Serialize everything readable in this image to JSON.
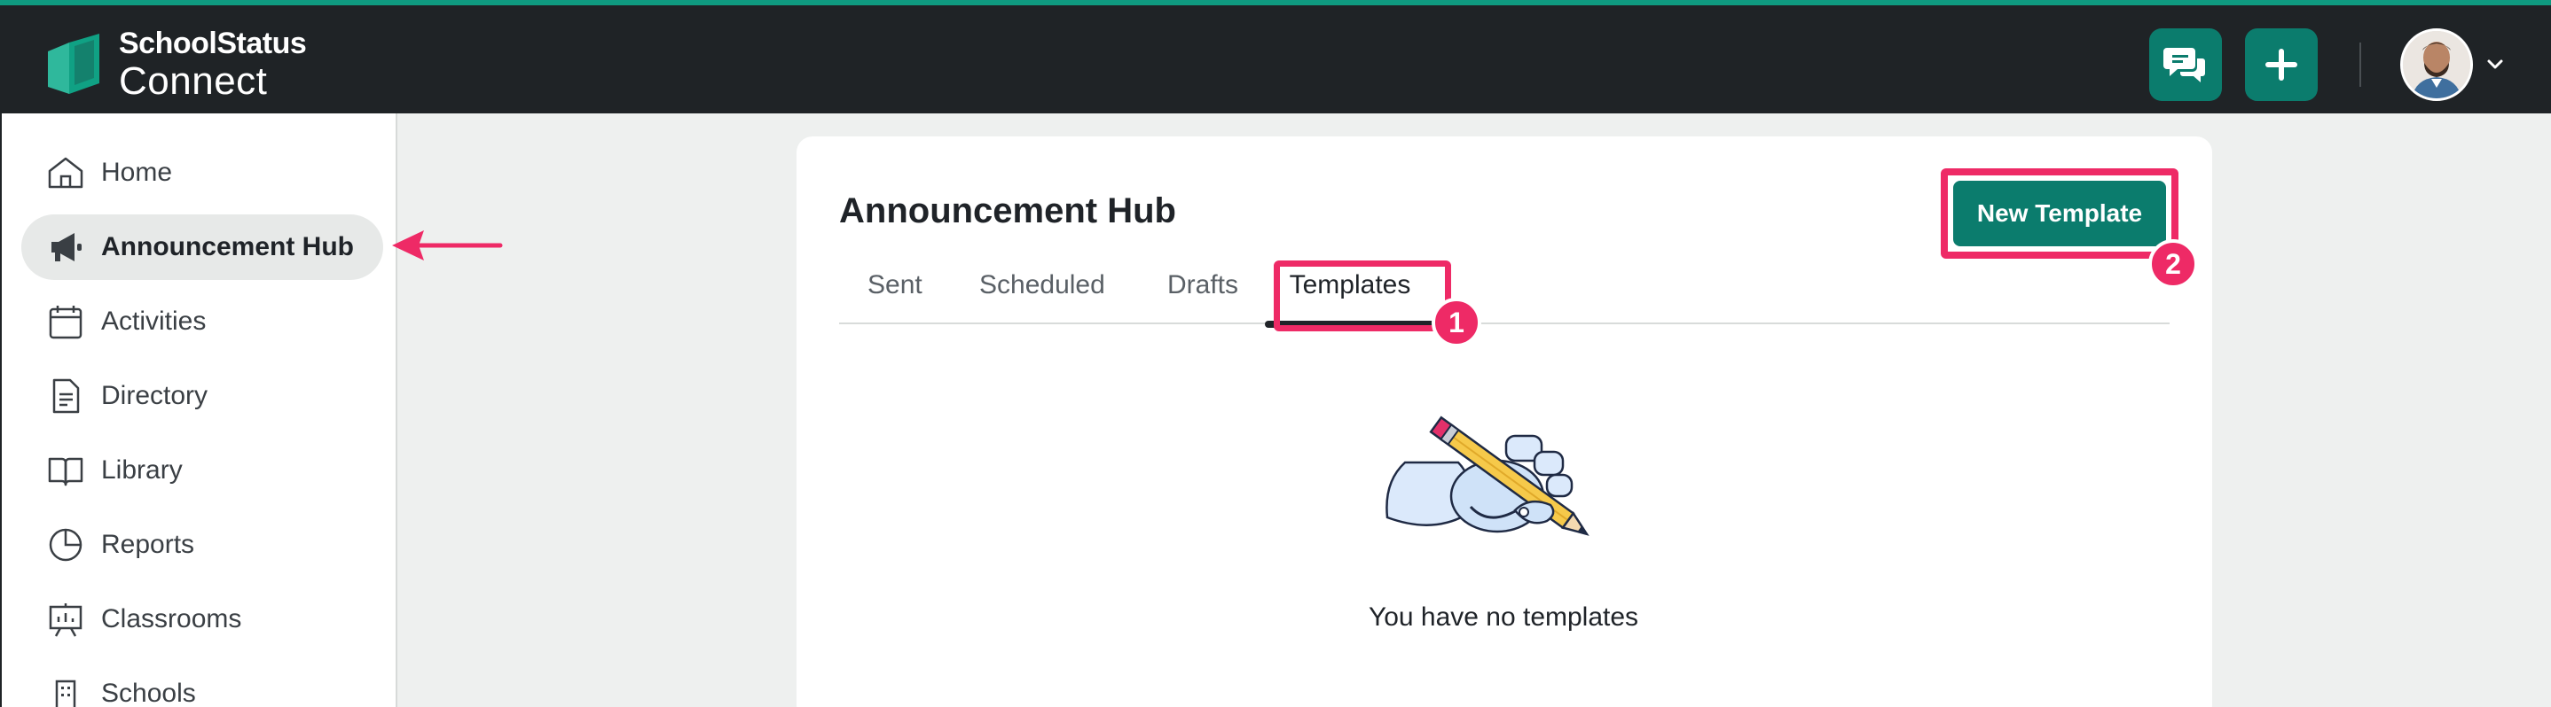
{
  "app": {
    "brand_top": "SchoolStatus",
    "brand_bottom": "Connect",
    "accent_color": "#0b7c6d",
    "highlight_color": "#ee2a66"
  },
  "topbar": {
    "chat_icon": "chat-bubbles-icon",
    "add_icon": "plus-icon",
    "avatar_icon": "user-avatar",
    "caret_icon": "chevron-down-icon"
  },
  "sidebar": {
    "items": [
      {
        "label": "Home",
        "icon": "home-icon"
      },
      {
        "label": "Announcement Hub",
        "icon": "megaphone-icon",
        "active": true
      },
      {
        "label": "Activities",
        "icon": "calendar-icon"
      },
      {
        "label": "Directory",
        "icon": "document-icon"
      },
      {
        "label": "Library",
        "icon": "book-icon"
      },
      {
        "label": "Reports",
        "icon": "pie-chart-icon"
      },
      {
        "label": "Classrooms",
        "icon": "presentation-icon"
      },
      {
        "label": "Schools",
        "icon": "building-icon"
      }
    ]
  },
  "main": {
    "title": "Announcement Hub",
    "new_template_label": "New Template",
    "tabs": [
      {
        "label": "Sent"
      },
      {
        "label": "Scheduled"
      },
      {
        "label": "Drafts"
      },
      {
        "label": "Templates",
        "active": true
      }
    ],
    "empty_message": "You have no templates"
  },
  "annotations": {
    "step_1": "1",
    "step_2": "2"
  }
}
